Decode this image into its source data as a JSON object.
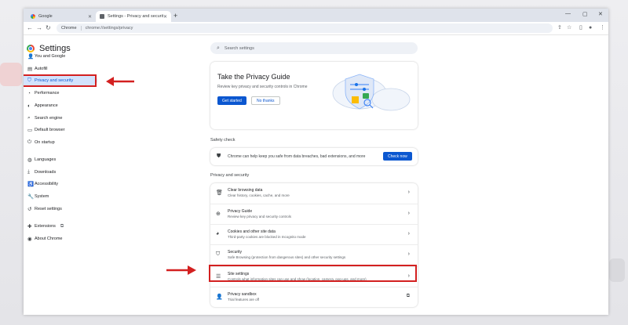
{
  "tabs": [
    {
      "label": "Google",
      "favicon": "google-icon"
    },
    {
      "label": "Settings - Privacy and security",
      "favicon": "settings-icon"
    }
  ],
  "toolbar": {
    "chip": "Chrome",
    "url": "chrome://settings/privacy"
  },
  "header": {
    "title": "Settings",
    "search_placeholder": "Search settings"
  },
  "sidebar": {
    "items": [
      {
        "label": "You and Google",
        "icon": "person-icon"
      },
      {
        "label": "Autofill",
        "icon": "autofill-icon"
      },
      {
        "label": "Privacy and security",
        "icon": "shield-icon",
        "active": true
      },
      {
        "label": "Performance",
        "icon": "speed-icon"
      },
      {
        "label": "Appearance",
        "icon": "palette-icon"
      },
      {
        "label": "Search engine",
        "icon": "search-icon"
      },
      {
        "label": "Default browser",
        "icon": "browser-icon"
      },
      {
        "label": "On startup",
        "icon": "power-icon"
      },
      {
        "label": "Languages",
        "icon": "globe-icon"
      },
      {
        "label": "Downloads",
        "icon": "download-icon"
      },
      {
        "label": "Accessibility",
        "icon": "accessibility-icon"
      },
      {
        "label": "System",
        "icon": "wrench-icon"
      },
      {
        "label": "Reset settings",
        "icon": "reset-icon"
      },
      {
        "label": "Extensions",
        "icon": "puzzle-icon"
      },
      {
        "label": "About Chrome",
        "icon": "chrome-icon"
      }
    ]
  },
  "privacy_guide": {
    "title": "Take the Privacy Guide",
    "subtitle": "Review key privacy and security controls in Chrome",
    "primary_button": "Get started",
    "secondary_button": "No thanks"
  },
  "safety_check": {
    "section_label": "Safety check",
    "text": "Chrome can help keep you safe from data breaches, bad extensions, and more",
    "button": "Check now"
  },
  "privacy_section": {
    "label": "Privacy and security",
    "rows": [
      {
        "title": "Clear browsing data",
        "subtitle": "Clear history, cookies, cache, and more",
        "icon": "trash-icon",
        "trailing": "chevron-right-icon"
      },
      {
        "title": "Privacy Guide",
        "subtitle": "Review key privacy and security controls",
        "icon": "compass-icon",
        "trailing": "chevron-right-icon"
      },
      {
        "title": "Cookies and other site data",
        "subtitle": "Third-party cookies are blocked in Incognito mode",
        "icon": "cookie-icon",
        "trailing": "chevron-right-icon"
      },
      {
        "title": "Security",
        "subtitle": "Safe Browsing (protection from dangerous sites) and other security settings",
        "icon": "security-icon",
        "trailing": "chevron-right-icon"
      },
      {
        "title": "Site settings",
        "subtitle": "Controls what information sites can use and show (location, camera, pop-ups, and more)",
        "icon": "sliders-icon",
        "trailing": "chevron-right-icon"
      },
      {
        "title": "Privacy sandbox",
        "subtitle": "Trial features are off",
        "icon": "sandbox-icon",
        "trailing": "external-link-icon"
      }
    ]
  },
  "colors": {
    "accent": "#0b57d0",
    "annotation_red": "#d32020",
    "active_nav_bg": "#d3e3fd"
  }
}
